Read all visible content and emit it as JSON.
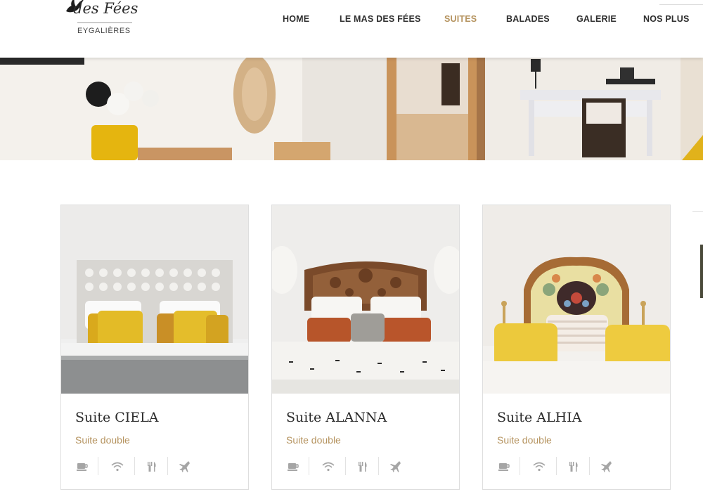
{
  "brand": {
    "script_name": "des Fées",
    "location": "EYGALIÈRES"
  },
  "nav": {
    "items": [
      {
        "label": "HOME",
        "active": false
      },
      {
        "label": "LE MAS DES FÉES",
        "active": false
      },
      {
        "label": "SUITES",
        "active": true
      },
      {
        "label": "BALADES",
        "active": false
      },
      {
        "label": "GALERIE",
        "active": false
      },
      {
        "label": "NOS PLUS",
        "active": false
      }
    ]
  },
  "colors": {
    "accent": "#b5935f",
    "text_dark": "#2e2e2e",
    "icon_gray": "#9a9a9a"
  },
  "suites": [
    {
      "title": "Suite CIELA",
      "subtitle": "Suite double",
      "headboard": "white-carved",
      "pillows": "mustard"
    },
    {
      "title": "Suite ALANNA",
      "subtitle": "Suite double",
      "headboard": "wood-carved",
      "pillows": "rust"
    },
    {
      "title": "Suite ALHIA",
      "subtitle": "Suite double",
      "headboard": "painted-floral",
      "pillows": "yellow"
    }
  ],
  "amenities": [
    "coffee-icon",
    "wifi-icon",
    "restaurant-icon",
    "airport-icon"
  ]
}
